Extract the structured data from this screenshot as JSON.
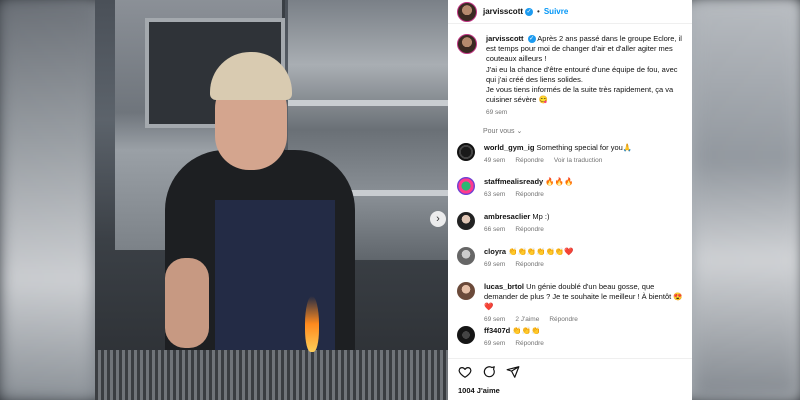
{
  "header": {
    "username": "jarvisscott",
    "separator": "•",
    "follow_label": "Suivre"
  },
  "caption": {
    "username": "jarvisscott",
    "lines": [
      "Après 2 ans passé dans le groupe Eclore, il est temps pour moi de changer d'air et d'aller agiter mes couteaux ailleurs !",
      "J'ai eu la chance d'être entouré d'une équipe de fou, avec qui j'ai créé des liens solides.",
      "Je vous tiens informés de la suite très rapidement, ça va cuisiner sévère 😋"
    ],
    "time": "69 sem"
  },
  "pour_vous": "Pour vous ⌄",
  "comments": [
    {
      "username": "world_gym_ig",
      "text": "Something special for you🙏",
      "time": "49 sem",
      "reply": "Répondre",
      "translate": "Voir la traduction"
    },
    {
      "username": "staffmealisready",
      "text": "🔥🔥🔥",
      "time": "63 sem",
      "reply": "Répondre"
    },
    {
      "username": "ambresaclier",
      "text": "Mp :)",
      "time": "66 sem",
      "reply": "Répondre"
    },
    {
      "username": "cloyra",
      "text": "👏👏👏👏👏👏❤️",
      "time": "69 sem",
      "reply": "Répondre"
    },
    {
      "username": "lucas_brtol",
      "text": "Un génie doublé d'un beau gosse, que demander de plus ? Je te souhaite le meilleur ! À bientôt 😍❤️",
      "time": "69 sem",
      "likes": "2 J'aime",
      "reply": "Répondre"
    },
    {
      "username": "ff3407d",
      "text": "👏👏👏",
      "time": "69 sem",
      "reply": "Répondre"
    }
  ],
  "actions": {
    "likes": "1004 J'aime",
    "icons": [
      "heart-icon",
      "comment-icon",
      "share-icon"
    ]
  },
  "photo": {
    "next_glyph": "›"
  },
  "colors": {
    "accent": "#0095f6",
    "verified": "#1d9bf0",
    "muted": "#737373"
  }
}
